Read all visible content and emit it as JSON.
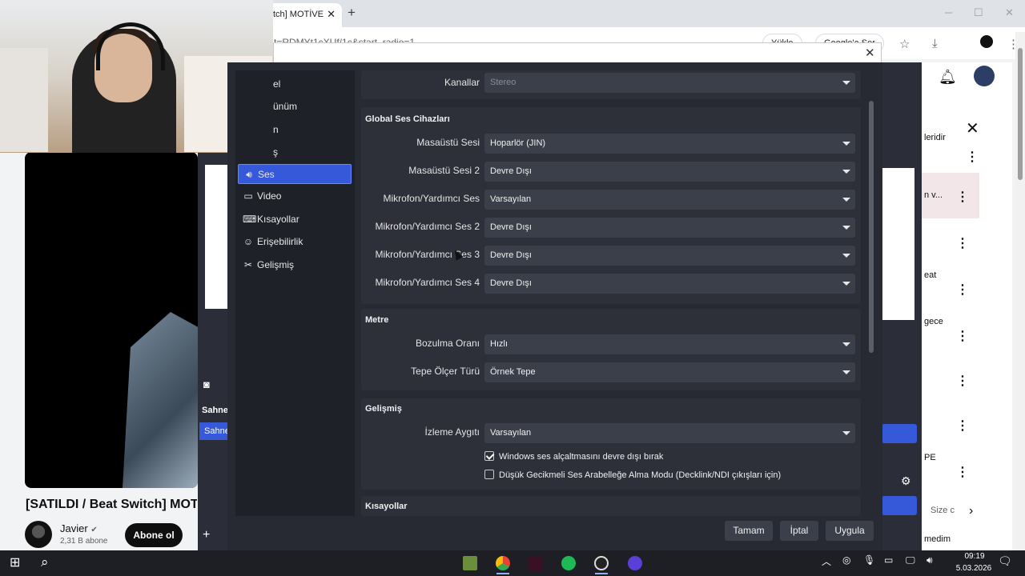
{
  "browser": {
    "tab_title": "tch] MOTİVE",
    "url_fragment": "t=RDMYt1cXUf/1c&start_radio=1",
    "pill_1": "Yükle",
    "pill_2": "Google'a Ser"
  },
  "youtube": {
    "video_title": "[SATILDI / Beat Switch] MOTİ",
    "channel": "Javier",
    "subscribers": "2,31 B abone",
    "subscribe_button": "Abone ol",
    "side_panel": [
      "leridir",
      "n v...",
      "eat",
      "gece",
      "PE",
      "Size c",
      "medim"
    ]
  },
  "obs_background": {
    "scene_header": "Sahne",
    "scene_item": "Sahne"
  },
  "dialog": {
    "nav_partial": [
      "el",
      "ünüm",
      "n",
      "ş"
    ],
    "nav": [
      {
        "label": "Ses",
        "icon": "speaker-icon"
      },
      {
        "label": "Video",
        "icon": "monitor-icon"
      },
      {
        "label": "Kısayollar",
        "icon": "keyboard-icon"
      },
      {
        "label": "Erişebilirlik",
        "icon": "accessibility-icon"
      },
      {
        "label": "Gelişmiş",
        "icon": "wrench-icon"
      }
    ],
    "channels": {
      "label": "Kanallar",
      "value": "Stereo"
    },
    "global_audio": {
      "title": "Global Ses Cihazları",
      "rows": [
        {
          "label": "Masaüstü Sesi",
          "value": "Hoparlör (JIN)"
        },
        {
          "label": "Masaüstü Sesi 2",
          "value": "Devre Dışı"
        },
        {
          "label": "Mikrofon/Yardımcı Ses",
          "value": "Varsayılan"
        },
        {
          "label": "Mikrofon/Yardımcı Ses 2",
          "value": "Devre Dışı"
        },
        {
          "label": "Mikrofon/Yardımcı Ses 3",
          "value": "Devre Dışı"
        },
        {
          "label": "Mikrofon/Yardımcı Ses 4",
          "value": "Devre Dışı"
        }
      ]
    },
    "meters": {
      "title": "Metre",
      "rows": [
        {
          "label": "Bozulma Oranı",
          "value": "Hızlı"
        },
        {
          "label": "Tepe Ölçer Türü",
          "value": "Örnek Tepe"
        }
      ]
    },
    "advanced": {
      "title": "Gelişmiş",
      "monitoring": {
        "label": "İzleme Aygıtı",
        "value": "Varsayılan"
      },
      "check_1": {
        "label": "Windows ses alçaltmasını devre dışı bırak",
        "checked": true
      },
      "check_2": {
        "label": "Düşük Gecikmeli Ses Arabelleğe Alma Modu (Decklink/NDI çıkışları için)",
        "checked": false
      }
    },
    "hotkeys_title": "Kısayollar",
    "buttons": {
      "ok": "Tamam",
      "cancel": "İptal",
      "apply": "Uygula"
    }
  },
  "taskbar": {
    "time": "09:19",
    "date": "5.03.2026"
  },
  "colors": {
    "accent": "#3559d8",
    "dialog_bg": "#272a33",
    "group_bg": "#2d3039",
    "combo_bg": "#3b3f4a"
  }
}
